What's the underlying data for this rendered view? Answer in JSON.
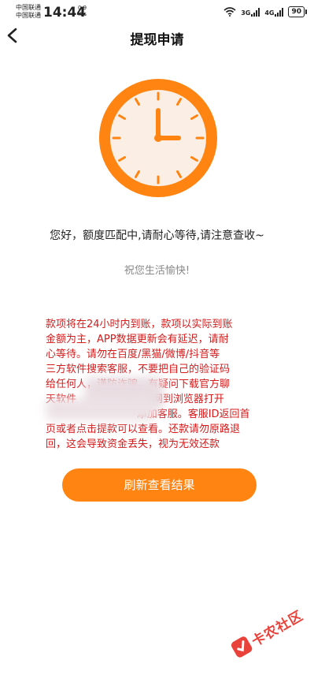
{
  "status_bar": {
    "carrier_1": "中国联通",
    "carrier_2": "中国联通",
    "time": "14:44",
    "net_speed_value": "0.9",
    "net_speed_unit": "K/s",
    "signal_1": "3G",
    "signal_2": "4G",
    "battery": "90"
  },
  "header": {
    "title": "提现申请"
  },
  "main": {
    "message": "您好，额度匹配中,请耐心等待,请注意查收~",
    "wish": "祝您生活愉快!",
    "notice_lines": [
      "款项将在24小时内到账，款项以实际到账",
      "金额为主，APP数据更新会有延迟，请耐",
      "心等待。请勿在百度/黑猫/微博/抖音等",
      "三方软件搜索客服，不要把自己的验证码",
      "给任何人，谨防诈骗。有疑问下载官方聊",
      "天软件              复制官网到浏览器打开",
      "                            添加客服。客服ID返回首",
      "页或者点击提款可以查看。还款请勿原路退",
      "回，这会导致资金丢失，视为无效还款"
    ],
    "refresh_button": "刷新查看结果"
  },
  "watermark": {
    "text": "卡农社区"
  },
  "colors": {
    "accent": "#ff8411",
    "notice": "#d41b1b"
  }
}
